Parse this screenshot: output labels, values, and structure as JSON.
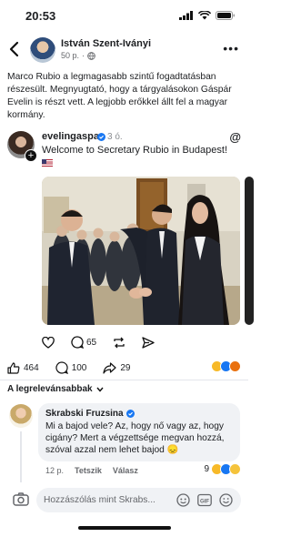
{
  "status_bar": {
    "time": "20:53"
  },
  "post": {
    "author": "István Szent-Iványi",
    "timestamp": "50 p.",
    "privacy_icon": "globe-icon",
    "text": "Marco Rubio a legmagasabb szintű fogadtatásban részesült. Megnyugtató, hogy a tárgyalásokon Gáspár Evelin is részt vett. A legjobb erőkkel állt fel a magyar kormány."
  },
  "embed": {
    "handle": "evelingaspar",
    "ago": "3 ó.",
    "text": "Welcome to Secretary Rubio in Budapest!",
    "likes_icon": "heart-icon",
    "comments": "65",
    "repost_icon": "repost-icon",
    "share_icon": "send-icon"
  },
  "stats": {
    "likes": "464",
    "comments": "100",
    "shares": "29"
  },
  "sort_label": "A legrelevánsabbak",
  "comment": {
    "author": "Skrabski Fruzsina",
    "text": "Mi a bajod vele? Az, hogy nő vagy az, hogy cigány? Mert a végzettsége megvan hozzá, szóval azzal nem lehet bajod 😞",
    "time": "12 p.",
    "like_label": "Tetszik",
    "reply_label": "Válasz",
    "reaction_count": "9"
  },
  "input": {
    "placeholder": "Hozzászólás mint Skrabs..."
  },
  "colors": {
    "accent": "#1877f2",
    "bubble": "#f0f2f5",
    "muted": "#65676b"
  }
}
